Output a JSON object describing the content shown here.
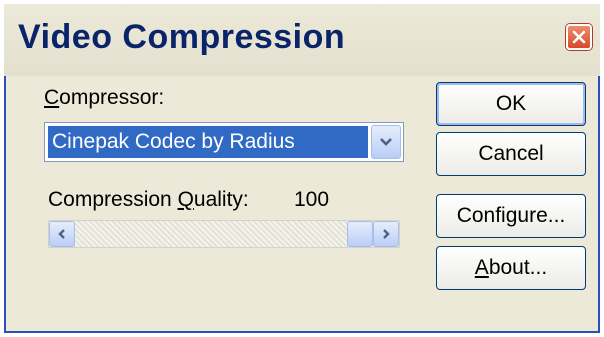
{
  "window": {
    "title": "Video Compression"
  },
  "compressor": {
    "label_pre": "",
    "label_mnemonic": "C",
    "label_post": "ompressor:",
    "selected": "Cinepak Codec by Radius"
  },
  "quality": {
    "label_pre": "Compression ",
    "label_mnemonic": "Q",
    "label_post": "uality:",
    "value": "100",
    "level_fraction": 1.0
  },
  "buttons": {
    "ok": "OK",
    "cancel": "Cancel",
    "configure_pre": "Confi",
    "configure_mnemonic": "g",
    "configure_post": "ure...",
    "about_pre": "",
    "about_mnemonic": "A",
    "about_post": "bout..."
  },
  "colors": {
    "title": "#0a246a",
    "selection": "#316ac5",
    "close": "#d7492c"
  }
}
